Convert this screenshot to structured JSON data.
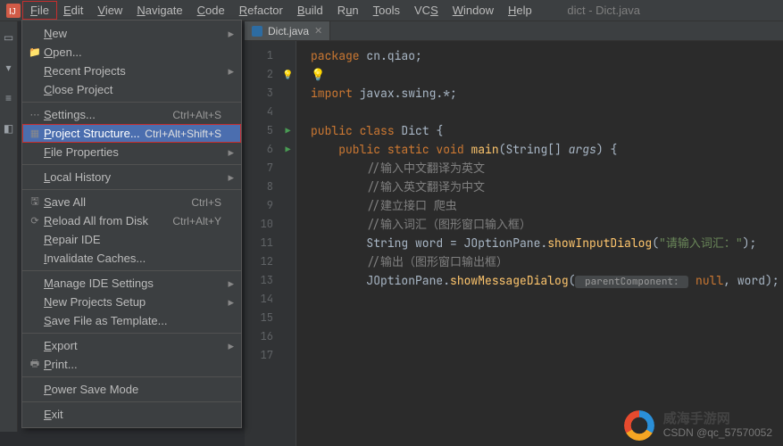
{
  "window": {
    "title": "dict - Dict.java"
  },
  "menubar": {
    "items": [
      "File",
      "Edit",
      "View",
      "Navigate",
      "Code",
      "Refactor",
      "Build",
      "Run",
      "Tools",
      "VCS",
      "Window",
      "Help"
    ]
  },
  "fileMenu": {
    "items": [
      {
        "label": "New",
        "icon": "",
        "shortcut": "",
        "arrow": true,
        "type": "item"
      },
      {
        "label": "Open...",
        "icon": "folder",
        "shortcut": "",
        "arrow": false,
        "type": "item"
      },
      {
        "label": "Recent Projects",
        "icon": "",
        "shortcut": "",
        "arrow": true,
        "type": "item"
      },
      {
        "label": "Close Project",
        "icon": "",
        "shortcut": "",
        "arrow": false,
        "type": "item"
      },
      {
        "type": "sep"
      },
      {
        "label": "Settings...",
        "icon": "dots",
        "shortcut": "Ctrl+Alt+S",
        "arrow": false,
        "type": "item"
      },
      {
        "label": "Project Structure...",
        "icon": "proj",
        "shortcut": "Ctrl+Alt+Shift+S",
        "arrow": false,
        "type": "item",
        "selected": true,
        "highlight": true
      },
      {
        "label": "File Properties",
        "icon": "",
        "shortcut": "",
        "arrow": true,
        "type": "item"
      },
      {
        "type": "sep"
      },
      {
        "label": "Local History",
        "icon": "",
        "shortcut": "",
        "arrow": true,
        "type": "item"
      },
      {
        "type": "sep"
      },
      {
        "label": "Save All",
        "icon": "save",
        "shortcut": "Ctrl+S",
        "arrow": false,
        "type": "item"
      },
      {
        "label": "Reload All from Disk",
        "icon": "reload",
        "shortcut": "Ctrl+Alt+Y",
        "arrow": false,
        "type": "item"
      },
      {
        "label": "Repair IDE",
        "icon": "",
        "shortcut": "",
        "arrow": false,
        "type": "item"
      },
      {
        "label": "Invalidate Caches...",
        "icon": "",
        "shortcut": "",
        "arrow": false,
        "type": "item"
      },
      {
        "type": "sep"
      },
      {
        "label": "Manage IDE Settings",
        "icon": "",
        "shortcut": "",
        "arrow": true,
        "type": "item"
      },
      {
        "label": "New Projects Setup",
        "icon": "",
        "shortcut": "",
        "arrow": true,
        "type": "item"
      },
      {
        "label": "Save File as Template...",
        "icon": "",
        "shortcut": "",
        "arrow": false,
        "type": "item"
      },
      {
        "type": "sep"
      },
      {
        "label": "Export",
        "icon": "",
        "shortcut": "",
        "arrow": true,
        "type": "item"
      },
      {
        "label": "Print...",
        "icon": "print",
        "shortcut": "",
        "arrow": false,
        "type": "item"
      },
      {
        "type": "sep"
      },
      {
        "label": "Power Save Mode",
        "icon": "",
        "shortcut": "",
        "arrow": false,
        "type": "item"
      },
      {
        "type": "sep"
      },
      {
        "label": "Exit",
        "icon": "",
        "shortcut": "",
        "arrow": false,
        "type": "item"
      }
    ]
  },
  "editor": {
    "tab": {
      "label": "Dict.java"
    },
    "lines": [
      "1",
      "2",
      "3",
      "4",
      "5",
      "6",
      "7",
      "8",
      "9",
      "10",
      "11",
      "12",
      "13",
      "14",
      "15",
      "16",
      "17"
    ],
    "marks": {
      "2": "bulb",
      "5": "run",
      "6": "run"
    },
    "code": {
      "l1": {
        "kw": "package",
        "rest": " cn.qiao;"
      },
      "l3": {
        "kw": "import",
        "rest": " javax.swing.*;"
      },
      "l5": {
        "pub": "public",
        "cls": " class",
        "name": " Dict",
        "brace": " {"
      },
      "l6": {
        "pub": "public",
        "stat": " static",
        "vvoid": " void",
        "main": " main",
        "sig": "(String[] ",
        "args": "args",
        "sig2": ") {"
      },
      "l7": "//输入中文翻译为英文",
      "l8": "//输入英文翻译为中文",
      "l9": "//建立接口 爬虫",
      "l10": "//输入词汇（图形窗口输入框）",
      "l11": {
        "t": "String word = JOptionPane.",
        "m": "showInputDialog",
        "s": "(\"请输入词汇：\");"
      },
      "l12": "//输出（图形窗口输出框）",
      "l13": {
        "t": "JOptionPane.",
        "m": "showMessageDialog",
        "open": "(",
        "hint": " parentComponent: ",
        "rest": " null, word);"
      }
    }
  },
  "watermark": {
    "big": "威海手游网",
    "small": "CSDN @qc_57570052"
  }
}
